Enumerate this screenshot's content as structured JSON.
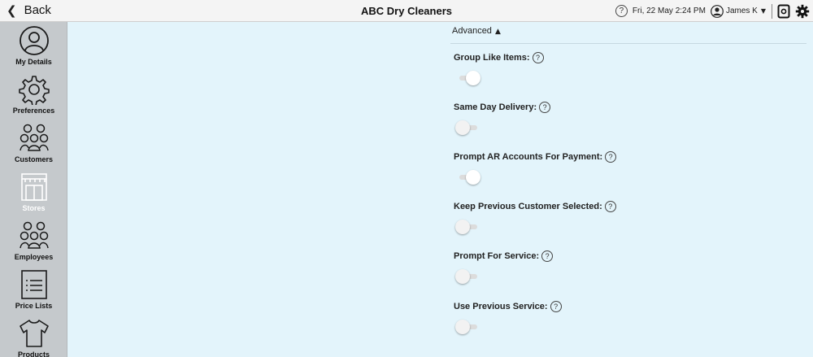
{
  "topbar": {
    "back_label": "Back",
    "title": "ABC Dry Cleaners",
    "help_glyph": "?",
    "datetime": "Fri, 22 May 2:24 PM",
    "user_name": "James K",
    "icons": [
      "chevron-left-icon",
      "help-icon",
      "user-avatar-icon",
      "caret-down-icon",
      "tablet-icon",
      "gear-icon"
    ]
  },
  "sidebar": {
    "items": [
      {
        "label": "My Details",
        "icon": "user-circle-icon",
        "active": false
      },
      {
        "label": "Preferences",
        "icon": "gear-icon",
        "active": false
      },
      {
        "label": "Customers",
        "icon": "customers-group-icon",
        "active": false
      },
      {
        "label": "Stores",
        "icon": "store-icon",
        "active": true
      },
      {
        "label": "Employees",
        "icon": "employees-group-icon",
        "active": false
      },
      {
        "label": "Price Lists",
        "icon": "price-list-icon",
        "active": false
      },
      {
        "label": "Products",
        "icon": "shirt-icon",
        "active": false
      }
    ]
  },
  "advanced": {
    "label": "Advanced",
    "expanded": true
  },
  "settings": [
    {
      "label": "Group Like Items:",
      "on": true
    },
    {
      "label": "Same Day Delivery:",
      "on": false
    },
    {
      "label": "Prompt AR Accounts For Payment:",
      "on": true
    },
    {
      "label": "Keep Previous Customer Selected:",
      "on": false
    },
    {
      "label": "Prompt For Service:",
      "on": false
    },
    {
      "label": "Use Previous Service:",
      "on": false
    }
  ],
  "colors": {
    "content_bg": "#e3f4fb",
    "sidebar_bg": "#c5c9cc",
    "topbar_bg": "#f4f4f4",
    "active_nav_label": "#ffffff"
  }
}
